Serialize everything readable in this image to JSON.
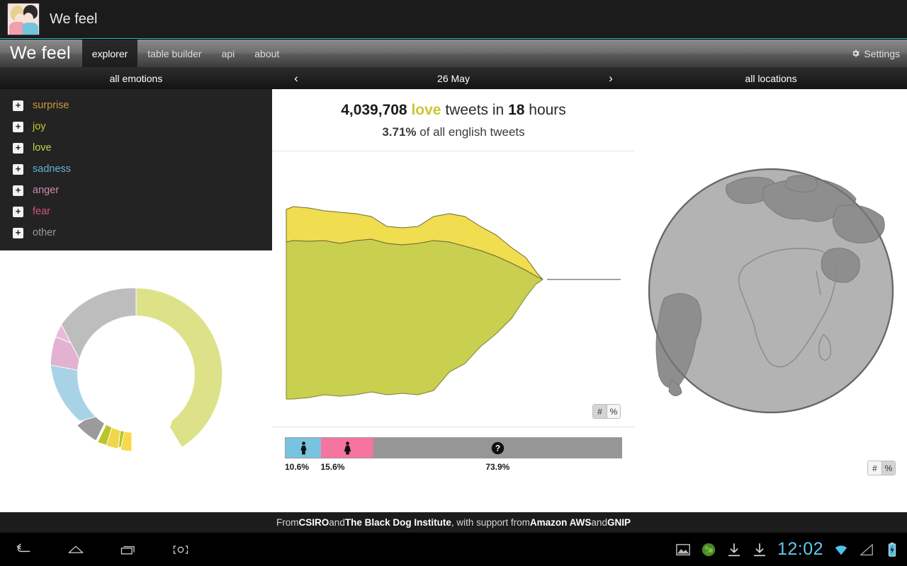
{
  "titlebar": {
    "app_title": "We feel",
    "icon_name": "app-icon-couple"
  },
  "navbar": {
    "brand": "We feel",
    "tabs": [
      {
        "label": "explorer",
        "active": true
      },
      {
        "label": "table builder",
        "active": false
      },
      {
        "label": "api",
        "active": false
      },
      {
        "label": "about",
        "active": false
      }
    ],
    "settings_label": "Settings",
    "settings_icon": "gear-icon"
  },
  "left_panel": {
    "header": "all emotions",
    "emotions": [
      {
        "label": "surprise",
        "color": "#c89a3c",
        "expander": "+"
      },
      {
        "label": "joy",
        "color": "#c9c832",
        "expander": "+"
      },
      {
        "label": "love",
        "color": "#c0d24a",
        "expander": "+"
      },
      {
        "label": "sadness",
        "color": "#6ab0cf",
        "expander": "+"
      },
      {
        "label": "anger",
        "color": "#d08ab0",
        "expander": "+"
      },
      {
        "label": "fear",
        "color": "#d1557a",
        "expander": "+"
      },
      {
        "label": "other",
        "color": "#9a9a9a",
        "expander": "+"
      }
    ]
  },
  "middle_panel": {
    "date": "26 May",
    "prev_arrow": "‹",
    "next_arrow": "›",
    "summary_count": "4,039,708",
    "summary_emotion": "love",
    "summary_mid": "tweets in",
    "summary_hours": "18",
    "summary_hours_unit": "hours",
    "summary_percent": "3.71%",
    "summary_percent_rest": "of all english tweets",
    "stream_toggle": {
      "count_label": "#",
      "percent_label": "%",
      "selected": "#"
    },
    "gender": {
      "segments": [
        {
          "name": "male",
          "percent": "10.6%",
          "value": 10.6,
          "color": "#78c4e0",
          "icon": "male-icon"
        },
        {
          "name": "female",
          "percent": "15.6%",
          "value": 15.6,
          "color": "#f574a0",
          "icon": "female-icon"
        },
        {
          "name": "unknown",
          "percent": "73.9%",
          "value": 73.9,
          "color": "#969696",
          "icon": "question-icon"
        }
      ]
    }
  },
  "right_panel": {
    "header": "all locations",
    "globe_icon": "globe-orthographic",
    "map_toggle": {
      "count_label": "#",
      "percent_label": "%",
      "selected": "%"
    }
  },
  "footer": {
    "prefix": "From ",
    "org1": "CSIRO",
    "mid1": " and ",
    "org2": "The Black Dog Institute",
    "mid2": ", with support from ",
    "org3": "Amazon AWS",
    "mid3": " and ",
    "org4": "GNIP"
  },
  "system_bar": {
    "back_icon": "back-icon",
    "home_icon": "home-icon",
    "recents_icon": "recents-icon",
    "screenshot_icon": "screenshot-icon",
    "gallery_icon": "image-icon",
    "app_notification_icon": "green-app-icon",
    "download_icon_1": "download-icon",
    "download_icon_2": "download-icon",
    "clock": "12:02",
    "wifi_icon": "wifi-icon",
    "signal_icon": "signal-icon",
    "battery_icon": "battery-charging-icon"
  },
  "chart_data": [
    {
      "type": "area",
      "name": "emotion-stream-graph",
      "title": "love tweets over time",
      "stacked": true,
      "grid": false,
      "xlabel": "",
      "ylabel": "",
      "x": [
        0,
        1,
        2,
        3,
        4,
        5,
        6,
        7,
        8,
        9,
        10,
        11,
        12,
        13,
        14,
        15,
        16,
        17,
        18,
        19,
        20,
        21,
        22,
        23
      ],
      "series": [
        {
          "name": "love",
          "color": "#c9cf4f",
          "values": [
            60,
            60,
            59,
            58,
            58,
            57,
            56,
            55,
            55,
            56,
            55,
            54,
            53,
            54,
            53,
            52,
            48,
            42,
            34,
            24,
            12,
            0,
            0,
            0
          ]
        },
        {
          "name": "joy",
          "color": "#f0dd50",
          "values": [
            34,
            35,
            34,
            33,
            32,
            31,
            31,
            33,
            30,
            30,
            32,
            33,
            31,
            28,
            24,
            21,
            18,
            15,
            11,
            7,
            4,
            0,
            0,
            0
          ]
        }
      ],
      "toggle_selected": "#"
    },
    {
      "type": "pie",
      "name": "emotion-donut-chart",
      "title": "all emotions breakdown",
      "donut": true,
      "labels": [
        "love",
        "joy",
        "other",
        "anger",
        "sadness",
        "surprise",
        "fear"
      ],
      "values": [
        46.0,
        14.5,
        8.0,
        6.5,
        17.0,
        5.0,
        3.0
      ],
      "colors": [
        "#dde289",
        "#b9c62a",
        "#b9b9b9",
        "#e3b2d0",
        "#a8d3e6",
        "#f2d64a",
        "#b0b0b0"
      ]
    },
    {
      "type": "bar",
      "name": "gender-distribution-bar",
      "title": "gender distribution",
      "orientation": "horizontal",
      "stacked": true,
      "categories": [
        "male",
        "female",
        "unknown"
      ],
      "values": [
        10.6,
        15.6,
        73.9
      ],
      "colors": [
        "#78c4e0",
        "#f574a0",
        "#969696"
      ],
      "ylim": [
        0,
        100
      ]
    }
  ]
}
